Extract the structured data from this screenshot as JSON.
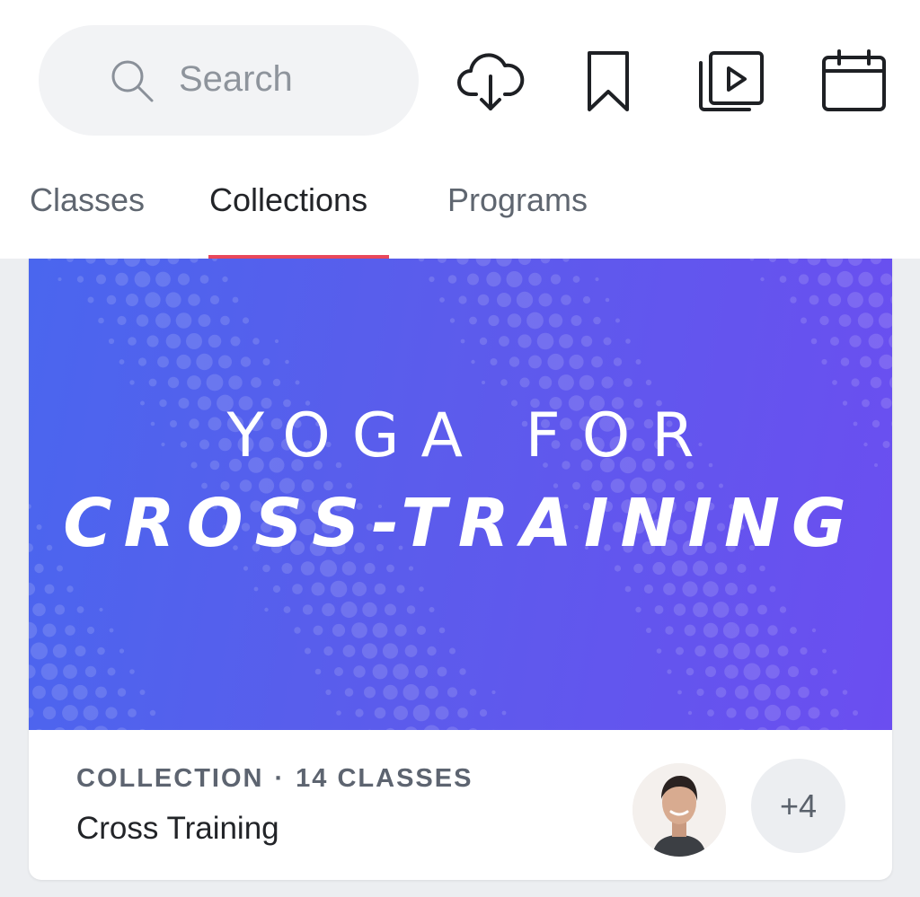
{
  "search": {
    "placeholder": "Search",
    "icon": "search-icon"
  },
  "toolbar": {
    "icons": [
      "download-icon",
      "bookmark-icon",
      "video-library-icon",
      "calendar-icon"
    ]
  },
  "tabs": [
    {
      "label": "Classes",
      "active": false
    },
    {
      "label": "Collections",
      "active": true
    },
    {
      "label": "Programs",
      "active": false
    }
  ],
  "colors": {
    "accent": "#e9485c",
    "banner_start": "#4a66ee",
    "banner_end": "#6b4ef0"
  },
  "collection": {
    "banner_line1": "YOGA FOR",
    "banner_line2": "CROSS-TRAINING",
    "type": "COLLECTION",
    "separator": "·",
    "count": "14 CLASSES",
    "title": "Cross Training",
    "more_instructors": "+4"
  }
}
